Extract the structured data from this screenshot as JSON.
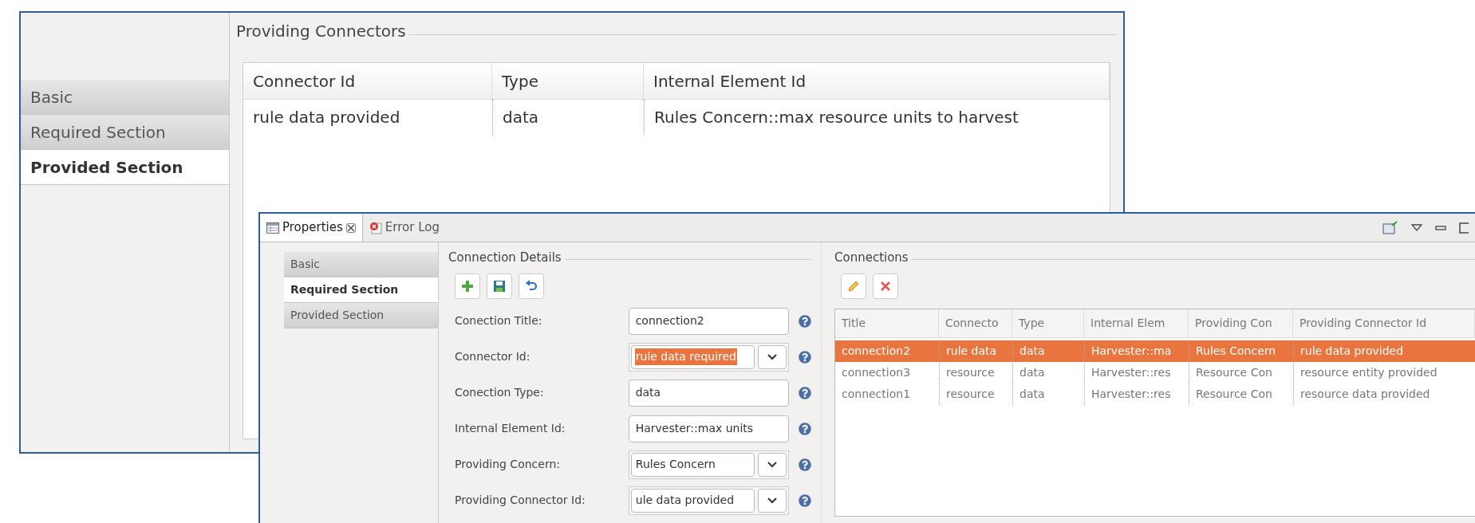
{
  "back_window": {
    "section_tabs": [
      {
        "label": "Basic",
        "selected": false
      },
      {
        "label": "Required Section",
        "selected": false
      },
      {
        "label": "Provided Section",
        "selected": true
      }
    ],
    "group_title": "Providing Connectors",
    "table": {
      "columns": [
        "Connector Id",
        "Type",
        "Internal Element Id"
      ],
      "rows": [
        [
          "rule data provided",
          "data",
          "Rules Concern::max resource units to harvest"
        ]
      ]
    }
  },
  "front_window": {
    "view_tabs": [
      {
        "label": "Properties",
        "selected": true,
        "closable": true
      },
      {
        "label": "Error Log",
        "selected": false,
        "closable": false
      }
    ],
    "section_tabs": [
      {
        "label": "Basic",
        "selected": false
      },
      {
        "label": "Required Section",
        "selected": true
      },
      {
        "label": "Provided Section",
        "selected": false
      }
    ],
    "details": {
      "title": "Connection Details",
      "fields": [
        {
          "label": "Conection Title:",
          "value": "connection2",
          "kind": "text",
          "highlighted": false
        },
        {
          "label": "Connector Id:",
          "value": "rule data required",
          "kind": "dropdown",
          "highlighted": true
        },
        {
          "label": "Conection Type:",
          "value": "data",
          "kind": "text",
          "highlighted": false
        },
        {
          "label": "Internal Element Id:",
          "value": "Harvester::max units",
          "kind": "text",
          "highlighted": false
        },
        {
          "label": "Providing Concern:",
          "value": "Rules Concern",
          "kind": "dropdown",
          "highlighted": false
        },
        {
          "label": "Providing Connector Id:",
          "value": "ule data provided",
          "kind": "dropdown",
          "highlighted": false
        }
      ]
    },
    "connections": {
      "title": "Connections",
      "columns": [
        "Title",
        "Connecto",
        "Type",
        "Internal Elem",
        "Providing Con",
        "Providing Connector Id"
      ],
      "rows": [
        {
          "cells": [
            "connection2",
            "rule data",
            "data",
            "Harvester::ma",
            "Rules Concern",
            "rule data provided"
          ],
          "selected": true
        },
        {
          "cells": [
            "connection3",
            "resource",
            "data",
            "Harvester::res",
            "Resource Con",
            "resource entity provided"
          ],
          "selected": false
        },
        {
          "cells": [
            "connection1",
            "resource",
            "data",
            "Harvester::res",
            "Resource Con",
            "resource data provided"
          ],
          "selected": false
        }
      ]
    }
  }
}
